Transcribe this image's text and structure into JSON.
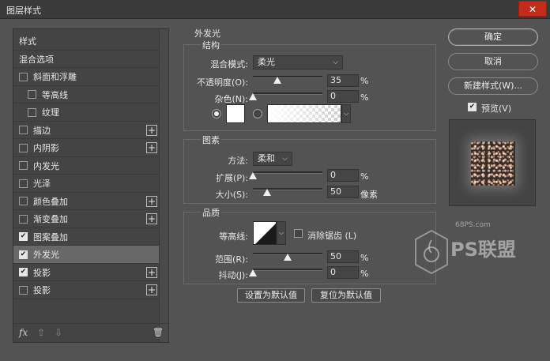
{
  "window": {
    "title": "图层样式",
    "close_glyph": "✕"
  },
  "styles_list": [
    {
      "label": "样式",
      "checkbox": false,
      "checked": false,
      "plus": false,
      "selected": false,
      "indent": 0
    },
    {
      "label": "混合选项",
      "checkbox": false,
      "checked": false,
      "plus": false,
      "selected": false,
      "indent": 0
    },
    {
      "label": "斜面和浮雕",
      "checkbox": true,
      "checked": false,
      "plus": false,
      "selected": false,
      "indent": 0
    },
    {
      "label": "等高线",
      "checkbox": true,
      "checked": false,
      "plus": false,
      "selected": false,
      "indent": 1
    },
    {
      "label": "纹理",
      "checkbox": true,
      "checked": false,
      "plus": false,
      "selected": false,
      "indent": 1
    },
    {
      "label": "描边",
      "checkbox": true,
      "checked": false,
      "plus": true,
      "selected": false,
      "indent": 0
    },
    {
      "label": "内阴影",
      "checkbox": true,
      "checked": false,
      "plus": true,
      "selected": false,
      "indent": 0
    },
    {
      "label": "内发光",
      "checkbox": true,
      "checked": false,
      "plus": false,
      "selected": false,
      "indent": 0
    },
    {
      "label": "光泽",
      "checkbox": true,
      "checked": false,
      "plus": false,
      "selected": false,
      "indent": 0
    },
    {
      "label": "颜色叠加",
      "checkbox": true,
      "checked": false,
      "plus": true,
      "selected": false,
      "indent": 0
    },
    {
      "label": "渐变叠加",
      "checkbox": true,
      "checked": false,
      "plus": true,
      "selected": false,
      "indent": 0
    },
    {
      "label": "图案叠加",
      "checkbox": true,
      "checked": true,
      "plus": false,
      "selected": false,
      "indent": 0
    },
    {
      "label": "外发光",
      "checkbox": true,
      "checked": true,
      "plus": false,
      "selected": true,
      "indent": 0
    },
    {
      "label": "投影",
      "checkbox": true,
      "checked": true,
      "plus": true,
      "selected": false,
      "indent": 0
    },
    {
      "label": "投影",
      "checkbox": true,
      "checked": false,
      "plus": true,
      "selected": false,
      "indent": 0
    }
  ],
  "bottom_icons": {
    "fx": "fx",
    "up": "⇧",
    "down": "⇩",
    "trash": "🗑"
  },
  "panel": {
    "title": "外发光",
    "structure": {
      "label": "结构",
      "blend_mode_label": "混合模式:",
      "blend_mode_value": "柔光",
      "opacity_label": "不透明度(O):",
      "opacity_value": "35",
      "opacity": 35,
      "noise_label": "杂色(N):",
      "noise_value": "0",
      "noise": 0,
      "percent": "%"
    },
    "elements": {
      "label": "图素",
      "technique_label": "方法:",
      "technique_value": "柔和",
      "spread_label": "扩展(P):",
      "spread_value": "0",
      "spread": 0,
      "size_label": "大小(S):",
      "size_value": "50",
      "size_unit": "像素",
      "size": 50,
      "percent": "%"
    },
    "quality": {
      "label": "品质",
      "contour_label": "等高线:",
      "antialias_label": "消除锯齿 (L)",
      "range_label": "范围(R):",
      "range_value": "50",
      "range": 50,
      "jitter_label": "抖动(J):",
      "jitter_value": "0",
      "jitter": 0,
      "percent": "%"
    },
    "set_default": "设置为默认值",
    "reset_default": "复位为默认值"
  },
  "buttons": {
    "ok": "确定",
    "cancel": "取消",
    "new_style": "新建样式(W)...",
    "preview_label": "预览(V)"
  },
  "watermark": {
    "site": "68PS.com",
    "brand": "PS联盟"
  },
  "colors": {
    "accent": "#f0f0f0",
    "background": "#535353",
    "close": "#c42b1c"
  }
}
